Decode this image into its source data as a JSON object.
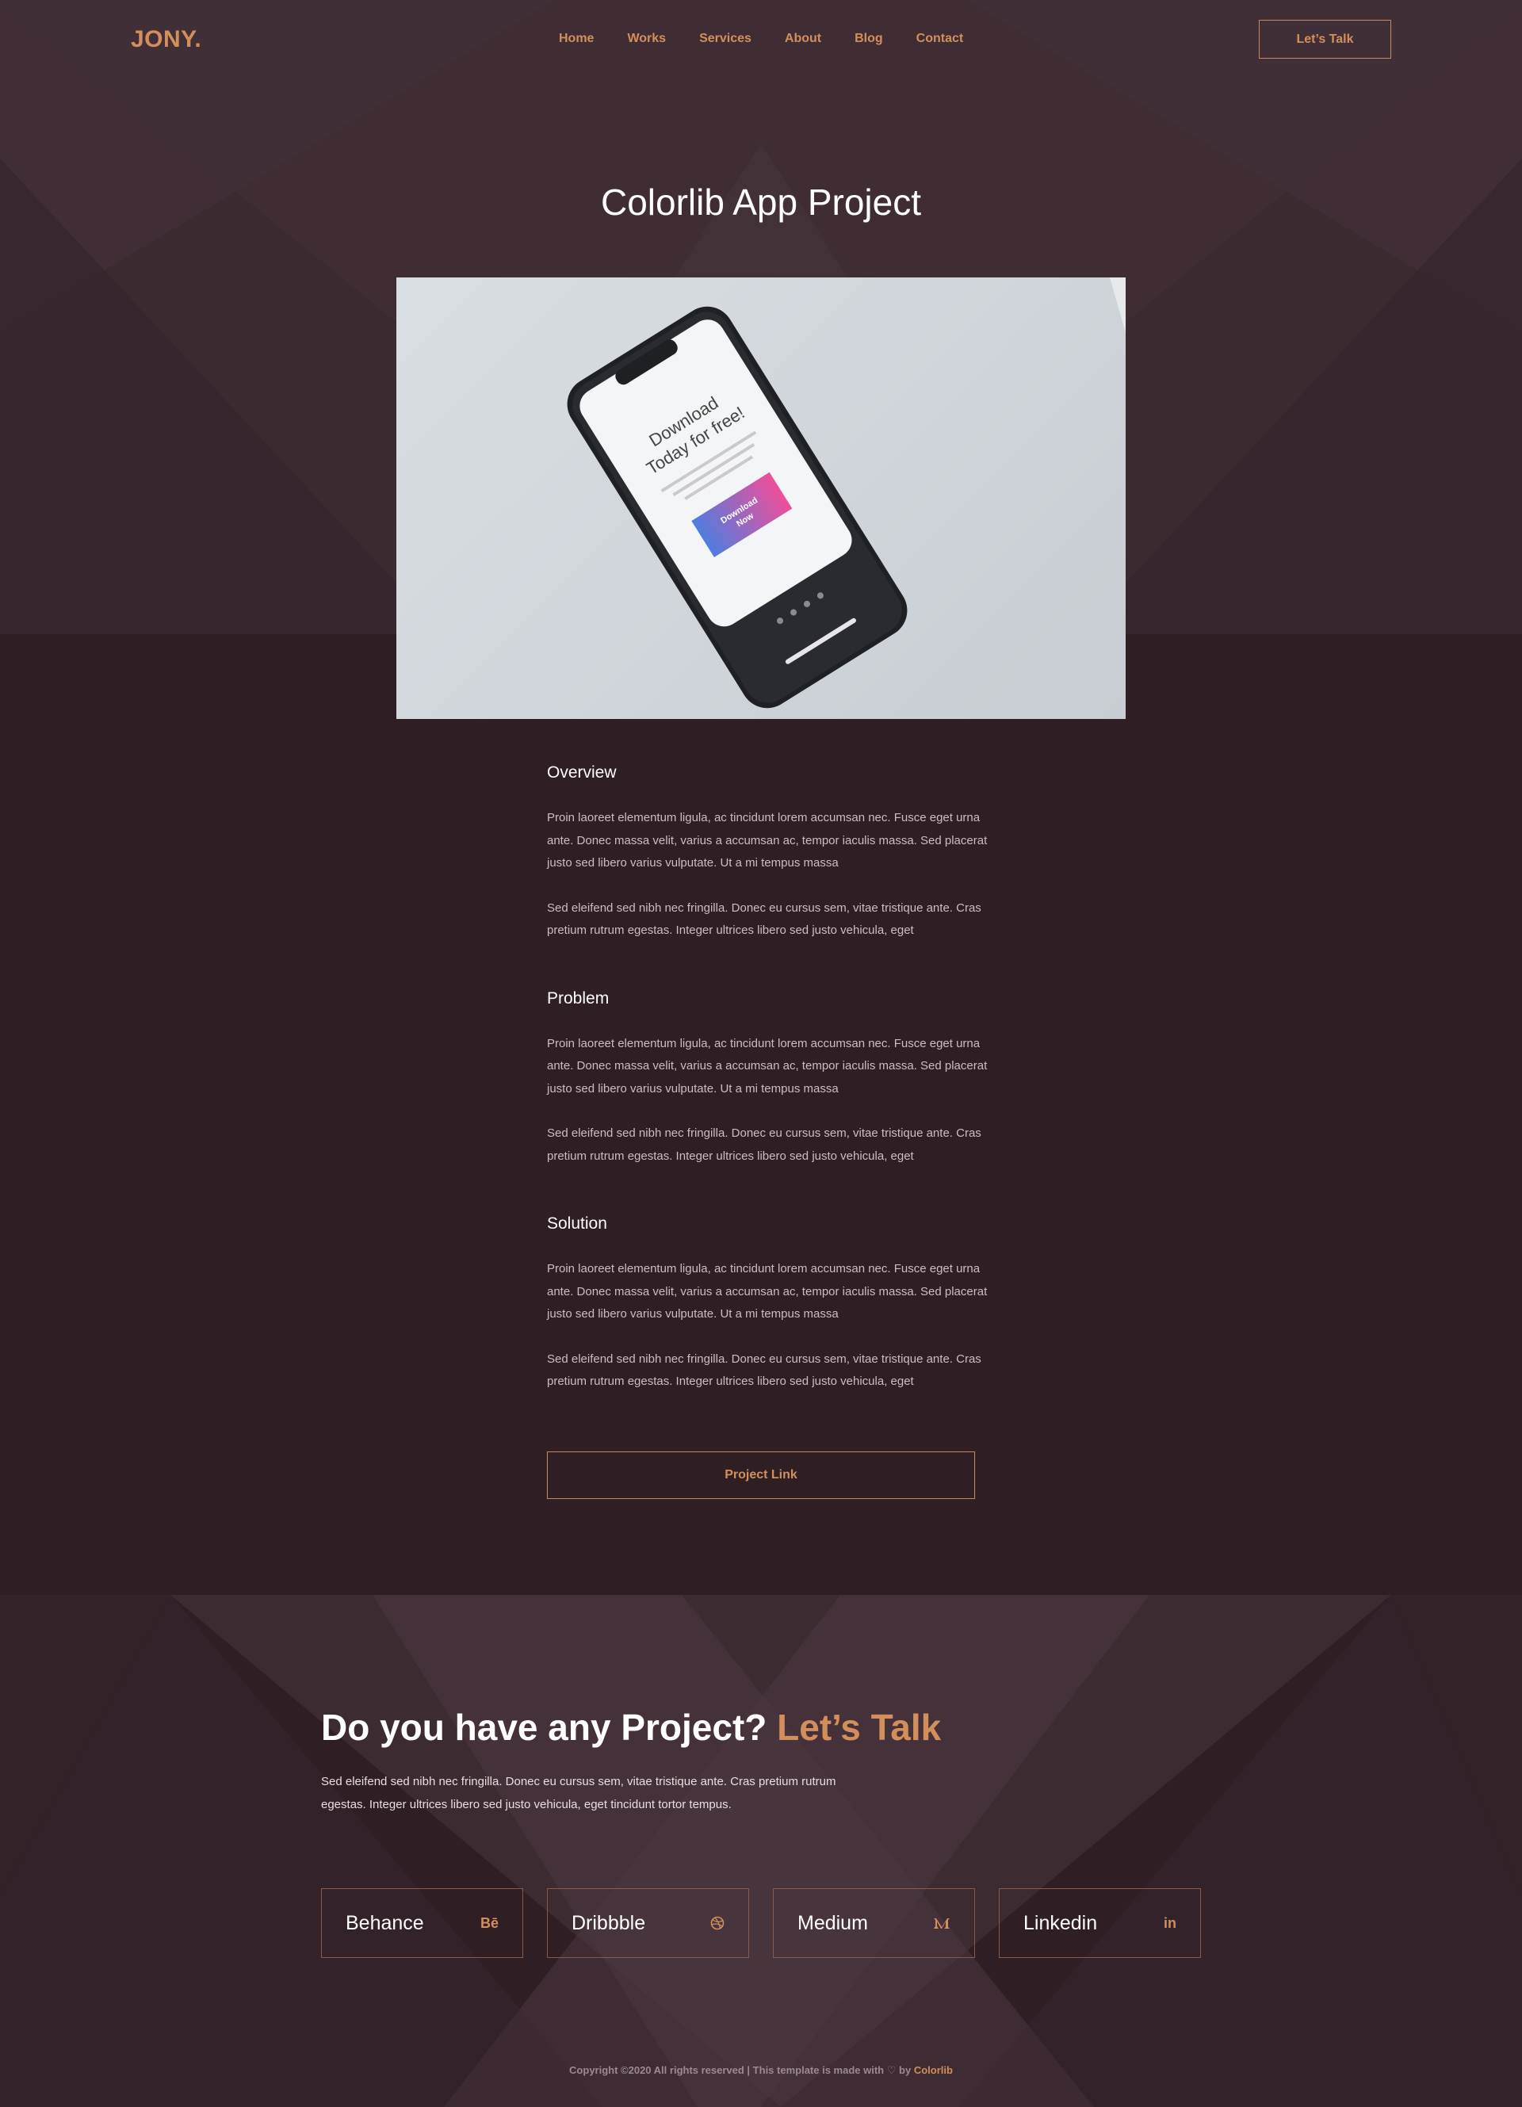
{
  "header": {
    "logo": "JONY.",
    "nav": [
      "Home",
      "Works",
      "Services",
      "About",
      "Blog",
      "Contact"
    ],
    "cta_label": "Let’s Talk"
  },
  "project": {
    "title": "Colorlib App Project",
    "phone_screen": {
      "heading_line1": "Download",
      "heading_line2": "Today for free!",
      "button_line1": "Download",
      "button_line2": "Now"
    },
    "sections": [
      {
        "title": "Overview",
        "paragraphs": [
          "Proin laoreet elementum ligula, ac tincidunt lorem accumsan nec. Fusce eget urna ante. Donec massa velit, varius a accumsan ac, tempor iaculis massa. Sed placerat justo sed libero varius vulputate. Ut a mi tempus massa",
          "Sed eleifend sed nibh nec fringilla. Donec eu cursus sem, vitae tristique ante. Cras pretium rutrum egestas. Integer ultrices libero sed justo vehicula, eget"
        ]
      },
      {
        "title": "Problem",
        "paragraphs": [
          "Proin laoreet elementum ligula, ac tincidunt lorem accumsan nec. Fusce eget urna ante. Donec massa velit, varius a accumsan ac, tempor iaculis massa. Sed placerat justo sed libero varius vulputate. Ut a mi tempus massa",
          "Sed eleifend sed nibh nec fringilla. Donec eu cursus sem, vitae tristique ante. Cras pretium rutrum egestas. Integer ultrices libero sed justo vehicula, eget"
        ]
      },
      {
        "title": "Solution",
        "paragraphs": [
          "Proin laoreet elementum ligula, ac tincidunt lorem accumsan nec. Fusce eget urna ante. Donec massa velit, varius a accumsan ac, tempor iaculis massa. Sed placerat justo sed libero varius vulputate. Ut a mi tempus massa",
          "Sed eleifend sed nibh nec fringilla. Donec eu cursus sem, vitae tristique ante. Cras pretium rutrum egestas. Integer ultrices libero sed justo vehicula, eget"
        ]
      }
    ],
    "link_label": "Project Link"
  },
  "cta": {
    "heading": "Do you have any Project?",
    "heading_accent": "Let’s Talk",
    "text": "Sed eleifend sed nibh nec fringilla. Donec eu cursus sem, vitae tristique ante. Cras pretium rutrum egestas. Integer ultrices libero sed justo vehicula, eget tincidunt tortor tempus."
  },
  "social": [
    {
      "label": "Behance",
      "icon": "behance-icon",
      "glyph": "Bē"
    },
    {
      "label": "Dribbble",
      "icon": "dribbble-icon",
      "glyph": ""
    },
    {
      "label": "Medium",
      "icon": "medium-icon",
      "glyph": ""
    },
    {
      "label": "Linkedin",
      "icon": "linkedin-icon",
      "glyph": "in"
    }
  ],
  "footer": {
    "copyright_prefix": "Copyright ©2020 All rights reserved | This template is made with",
    "by": "by",
    "brand": "Colorlib"
  },
  "colors": {
    "accent": "#d28f5c",
    "background": "#2f1e24",
    "hero_background": "#3c2a31"
  }
}
